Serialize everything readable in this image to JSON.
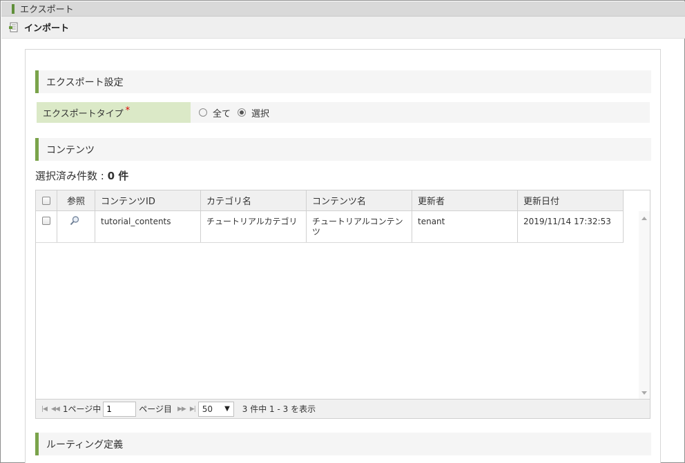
{
  "top_bars": {
    "export_label": "エクスポート",
    "import_label": "インポート"
  },
  "sections": {
    "export_settings": "エクスポート設定",
    "contents": "コンテンツ",
    "routing": "ルーティング定義"
  },
  "export_type": {
    "label": "エクスポートタイプ",
    "required_mark": "*",
    "options": [
      {
        "label": "全て",
        "checked": false
      },
      {
        "label": "選択",
        "checked": true
      }
    ]
  },
  "selected_count": {
    "prefix": "選択済み件数 : ",
    "value": "0 件"
  },
  "grid": {
    "columns": [
      "参照",
      "コンテンツID",
      "カテゴリ名",
      "コンテンツ名",
      "更新者",
      "更新日付"
    ],
    "rows": [
      {
        "content_id": "tutorial_contents",
        "category_name": "チュートリアルカテゴリ",
        "content_name": "チュートリアルコンテンツ",
        "updated_by": "tenant",
        "updated_at": "2019/11/14 17:32:53"
      }
    ]
  },
  "pager": {
    "page_of_prefix": "1ページ中",
    "page_value": "1",
    "page_suffix": "ページ目",
    "page_size": "50",
    "summary": "3 件中 1 - 3 を表示"
  },
  "colors": {
    "accent_green": "#7aa34a",
    "label_bg": "#dbe9c7"
  }
}
